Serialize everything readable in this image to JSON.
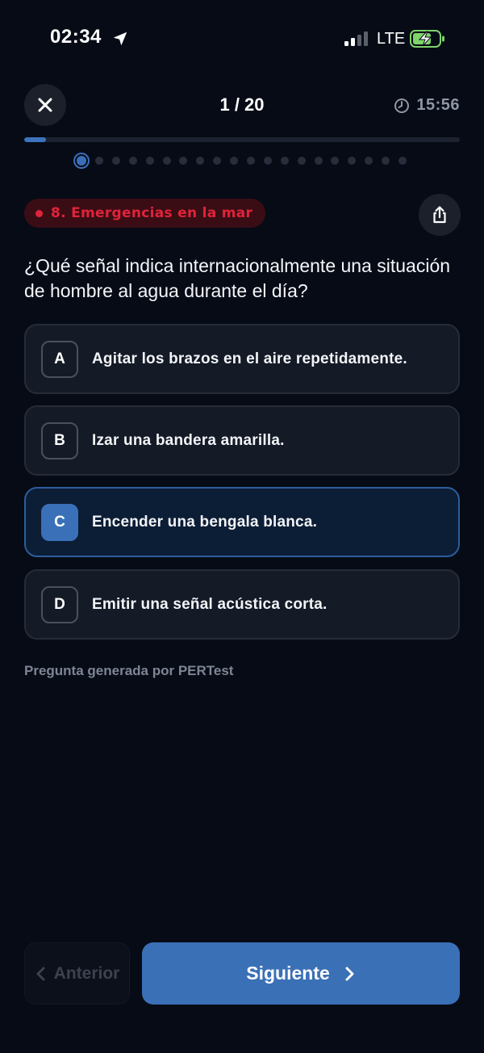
{
  "status_bar": {
    "time": "02:34",
    "network": "LTE",
    "icons": [
      "location-arrow-icon",
      "signal-icon",
      "battery-charging-icon"
    ]
  },
  "header": {
    "counter": "1 / 20",
    "timer": "15:56",
    "progress_fraction": 0.05,
    "total_questions": 20,
    "current_index": 0
  },
  "category": {
    "label": "8. Emergencias en la mar",
    "color": "#e0233a"
  },
  "question": {
    "text": "¿Qué señal indica internacionalmente una situación de hombre al agua durante el día?"
  },
  "options": [
    {
      "letter": "A",
      "text": "Agitar los brazos en el aire repetidamente."
    },
    {
      "letter": "B",
      "text": "Izar una bandera amarilla."
    },
    {
      "letter": "C",
      "text": "Encender una bengala blanca."
    },
    {
      "letter": "D",
      "text": "Emitir una señal acústica corta."
    }
  ],
  "selected_option": "C",
  "footer_note": "Pregunta generada por PERTest",
  "navigation": {
    "prev_label": "Anterior",
    "next_label": "Siguiente"
  },
  "colors": {
    "accent": "#3a70b6",
    "background": "#060b16"
  }
}
